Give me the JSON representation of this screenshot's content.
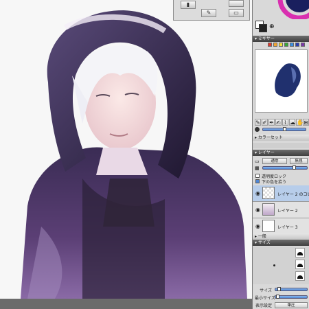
{
  "colors": {
    "canvas": "#f7f7f7",
    "panel": "#d9d9d9",
    "header": "#4a4a4a",
    "accent": "#4d86d6",
    "hoodie": "#3b2a52"
  },
  "tool_popup": {
    "icons": [
      "brush-tool-icon",
      "pen-tool-icon",
      "eraser-tool-icon"
    ]
  },
  "headers": {
    "mixer": "▾ ミキサー",
    "color_set": "▸ カラーセット",
    "layer": "▾ レイヤー",
    "general": "▸ 一般",
    "size": "▾ サイズ"
  },
  "mixer_swatches": [
    "#e23b2e",
    "#f0a531",
    "#f2e23a",
    "#3aa63a",
    "#3a8fe0",
    "#2a3fb0",
    "#7a3aa8"
  ],
  "layer_panel": {
    "blend_mode": "通常",
    "blend_mode_right": "無視",
    "opacity_percent": 70,
    "transparency_lock": "透明度ロック",
    "clip_below": "下の色を拾う",
    "layers": [
      {
        "name": "レイヤー 2 のコピー",
        "selected": true
      },
      {
        "name": "レイヤー 2",
        "selected": false
      },
      {
        "name": "レイヤー 3",
        "selected": false
      }
    ]
  },
  "size_panel": {
    "size_label": "サイズ",
    "min_size_label": "最小サイズ",
    "display_label": "表示設定",
    "display_value": "筆圧"
  }
}
